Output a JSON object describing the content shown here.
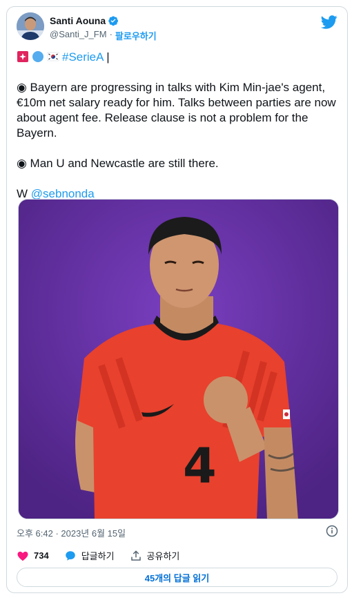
{
  "author": {
    "name": "Santi Aouna",
    "handle": "@Santi_J_FM",
    "separator": "·",
    "follow_label": "팔로우하기"
  },
  "tweet": {
    "flags_tail": "|",
    "hashtag": "#SerieA",
    "paragraph1_lines": [
      "◉ Bayern are progressing in talks with Kim Min-jae's agent,",
      "€10m net salary ready for him. Talks between parties are now",
      "about agent fee. Release clause is not a problem for the",
      "Bayern."
    ],
    "paragraph2": "◉ Man U and Newcastle are still there.",
    "credit_prefix": "W",
    "credit_mention": "@sebnonda"
  },
  "photo": {
    "jersey_number": "4"
  },
  "meta": {
    "timestamp": "오후 6:42 · 2023년 6월 15일"
  },
  "actions": {
    "like_count": "734",
    "reply_label": "답글하기",
    "share_label": "공유하기"
  },
  "read_replies_label": "45개의 답글 읽기",
  "colors": {
    "accent": "#1d9bf0",
    "like": "#f91880",
    "photo_background": "#5f2f9a",
    "jersey": "#e8412d"
  },
  "icons": [
    "verified-badge-icon",
    "twitter-bird-icon",
    "siren-emoji-icon",
    "blue-circle-emoji-icon",
    "korea-flag-emoji-icon",
    "info-icon",
    "heart-icon",
    "reply-bubble-icon",
    "share-icon"
  ]
}
